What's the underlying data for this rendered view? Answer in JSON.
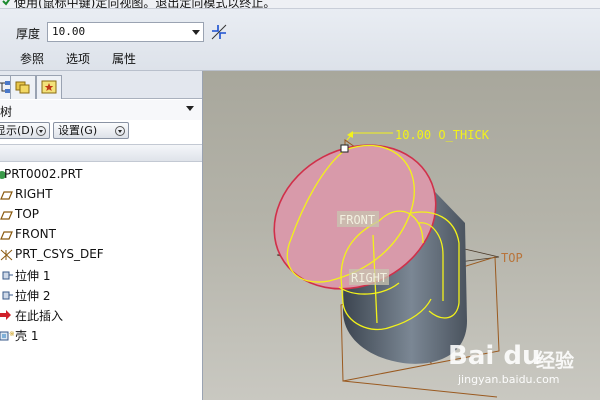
{
  "message_bar": {
    "text": "使用(鼠标中键)定向视图。退出定向模式以终止。",
    "icon": "check-arrow-icon"
  },
  "dashboard": {
    "thickness_label": "厚度",
    "thickness_value": "10.00",
    "flip_icon": "flip-direction-icon",
    "tabs": [
      "参照",
      "选项",
      "属性"
    ]
  },
  "model_tree": {
    "tabs": [
      "model-tree-tab-icon",
      "folder-browser-tab-icon",
      "favorites-tab-icon"
    ],
    "title": "树",
    "show_button": "显示(D)",
    "settings_button": "设置(G)",
    "items": [
      {
        "label": "PRT0002.PRT",
        "icon": "part-icon"
      },
      {
        "label": "RIGHT",
        "icon": "datum-plane-icon"
      },
      {
        "label": "TOP",
        "icon": "datum-plane-icon"
      },
      {
        "label": "FRONT",
        "icon": "datum-plane-icon"
      },
      {
        "label": "PRT_CSYS_DEF",
        "icon": "csys-icon"
      },
      {
        "label": "拉伸 1",
        "icon": "extrude-icon"
      },
      {
        "label": "拉伸 2",
        "icon": "extrude-icon"
      },
      {
        "label": "在此插入",
        "icon": "insert-here-arrow-icon"
      },
      {
        "label": "壳 1",
        "icon": "shell-icon"
      }
    ]
  },
  "viewport": {
    "dimension_label": "10.00 O_THICK",
    "datum_labels": {
      "front": "FRONT",
      "right": "RIGHT",
      "top": "TOP"
    },
    "colors": {
      "background": "#b0afa5",
      "top_face": "#d89aaa",
      "edge_red": "#d0304a",
      "highlight": "#f2f21a",
      "datum": "#b06a2a"
    }
  },
  "watermark": {
    "brand": "Bai du",
    "site_cn": "经验",
    "url": "jingyan.baidu.com"
  }
}
